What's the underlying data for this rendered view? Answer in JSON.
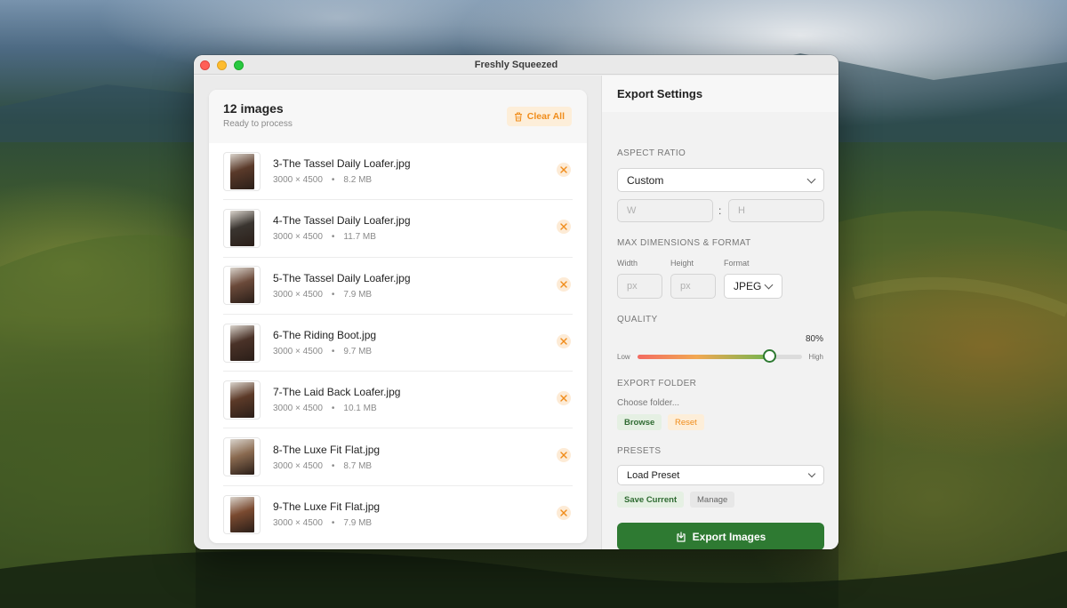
{
  "window": {
    "title": "Freshly Squeezed"
  },
  "image_list": {
    "count_label": "12 images",
    "status": "Ready to process",
    "clear_label": "Clear All",
    "items": [
      {
        "name": "3-The Tassel Daily Loafer.jpg",
        "dims": "3000 × 4500",
        "size": "8.2 MB",
        "thumb_color": "#5a3a2a"
      },
      {
        "name": "4-The Tassel Daily Loafer.jpg",
        "dims": "3000 × 4500",
        "size": "11.7 MB",
        "thumb_color": "#3a3530"
      },
      {
        "name": "5-The Tassel Daily Loafer.jpg",
        "dims": "3000 × 4500",
        "size": "7.9 MB",
        "thumb_color": "#6b4a3a"
      },
      {
        "name": "6-The Riding Boot.jpg",
        "dims": "3000 × 4500",
        "size": "9.7 MB",
        "thumb_color": "#4a3228"
      },
      {
        "name": "7-The Laid Back Loafer.jpg",
        "dims": "3000 × 4500",
        "size": "10.1 MB",
        "thumb_color": "#5c3a28"
      },
      {
        "name": "8-The Luxe Fit Flat.jpg",
        "dims": "3000 × 4500",
        "size": "8.7 MB",
        "thumb_color": "#8a6a50"
      },
      {
        "name": "9-The Luxe Fit Flat.jpg",
        "dims": "3000 × 4500",
        "size": "7.9 MB",
        "thumb_color": "#7a4a30"
      }
    ]
  },
  "settings": {
    "title": "Export Settings",
    "aspect": {
      "label": "ASPECT RATIO",
      "selected": "Custom",
      "w_placeholder": "W",
      "h_placeholder": "H",
      "separator": ":"
    },
    "max_dims": {
      "label": "MAX DIMENSIONS & FORMAT",
      "width_label": "Width",
      "height_label": "Height",
      "format_label": "Format",
      "width_placeholder": "px",
      "height_placeholder": "px",
      "format_selected": "JPEG"
    },
    "quality": {
      "label": "QUALITY",
      "value": 80,
      "value_text": "80%",
      "low_label": "Low",
      "high_label": "High"
    },
    "export_folder": {
      "label": "EXPORT FOLDER",
      "path": "Choose folder...",
      "browse_label": "Browse",
      "reset_label": "Reset"
    },
    "presets": {
      "label": "PRESETS",
      "selected": "Load Preset",
      "save_label": "Save Current",
      "manage_label": "Manage"
    },
    "export_label": "Export Images"
  },
  "colors": {
    "accent_green": "#2e7a32",
    "accent_orange": "#f08c1a"
  }
}
